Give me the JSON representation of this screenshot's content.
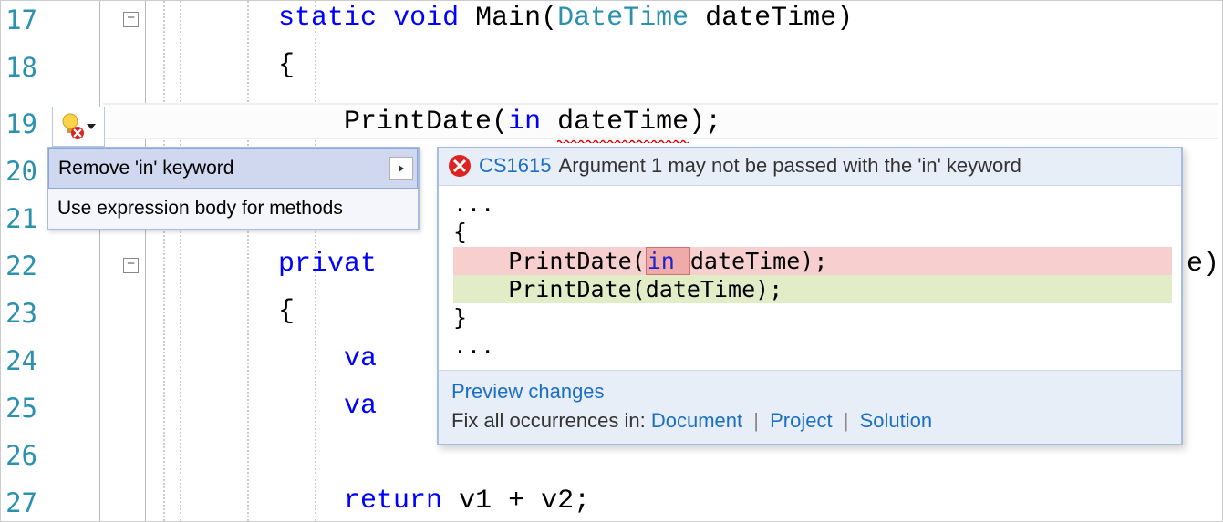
{
  "lines": {
    "start": 17,
    "end": 27,
    "17": {
      "tokens": [
        {
          "t": "        ",
          "c": "plain"
        },
        {
          "t": "static",
          "c": "kw"
        },
        {
          "t": " ",
          "c": "plain"
        },
        {
          "t": "void",
          "c": "kw"
        },
        {
          "t": " Main(",
          "c": "plain"
        },
        {
          "t": "DateTime",
          "c": "tp"
        },
        {
          "t": " dateTime)",
          "c": "plain"
        }
      ]
    },
    "18": {
      "tokens": [
        {
          "t": "        {",
          "c": "plain"
        }
      ]
    },
    "19": {
      "tokens": [
        {
          "t": "            PrintDate(",
          "c": "plain"
        },
        {
          "t": "in",
          "c": "kw"
        },
        {
          "t": " ",
          "c": "plain"
        },
        {
          "t": "dateTime",
          "c": "plain",
          "squiggle": true
        },
        {
          "t": ");",
          "c": "plain"
        }
      ]
    },
    "20": {
      "tokens": []
    },
    "21": {
      "tokens": []
    },
    "22": {
      "tokens": [
        {
          "t": "        ",
          "c": "plain"
        },
        {
          "t": "privat",
          "c": "kw"
        },
        {
          "t": "",
          "c": "plain",
          "gapstart": true
        },
        {
          "t": "e)",
          "c": "plain",
          "afterpop": true
        }
      ]
    },
    "23": {
      "tokens": [
        {
          "t": "        {",
          "c": "plain"
        }
      ]
    },
    "24": {
      "tokens": [
        {
          "t": "            ",
          "c": "plain"
        },
        {
          "t": "va",
          "c": "kw"
        }
      ]
    },
    "25": {
      "tokens": [
        {
          "t": "            ",
          "c": "plain"
        },
        {
          "t": "va",
          "c": "kw"
        }
      ]
    },
    "26": {
      "tokens": []
    },
    "27": {
      "tokens": [
        {
          "t": "            ",
          "c": "plain"
        },
        {
          "t": "return",
          "c": "kw"
        },
        {
          "t": " v1 + v2;",
          "c": "plain"
        }
      ]
    }
  },
  "bulb": {
    "label": "quick-actions"
  },
  "suggestions": [
    {
      "id": "remove-in",
      "label": "Remove 'in' keyword",
      "selected": true,
      "expandable": true
    },
    {
      "id": "expr-body",
      "label": "Use expression body for methods",
      "selected": false,
      "expandable": false
    }
  ],
  "preview": {
    "error_code": "CS1615",
    "error_msg": "Argument 1 may not be passed with the 'in' keyword",
    "diff": {
      "context_top": "...",
      "brace_open": "{",
      "removed_prefix": "    PrintDate(",
      "removed_kw": "in ",
      "removed_suffix": "dateTime);",
      "added": "    PrintDate(dateTime);",
      "brace_close": "}",
      "context_bot": "..."
    },
    "preview_link": "Preview changes",
    "fix_label": "Fix all occurrences in:",
    "fix_scopes": [
      "Document",
      "Project",
      "Solution"
    ]
  }
}
